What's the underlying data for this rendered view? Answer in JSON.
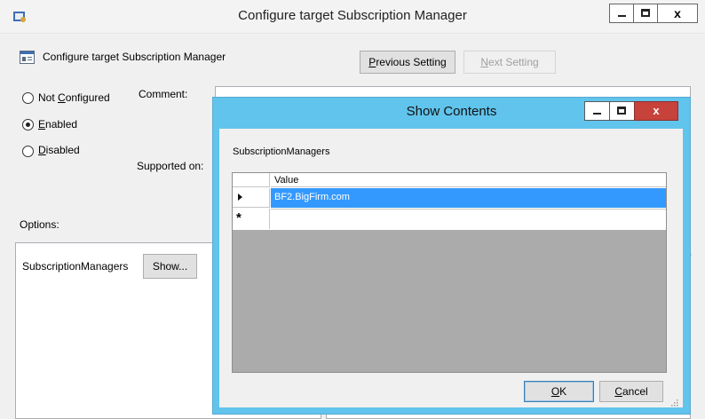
{
  "window": {
    "title": "Configure target Subscription Manager",
    "setting_name": "Configure target Subscription Manager",
    "previous_label": "Previous Setting",
    "next_label": "Next Setting"
  },
  "state": {
    "not_configured": "Not Configured",
    "enabled": "Enabled",
    "disabled": "Disabled",
    "selected": "Enabled"
  },
  "labels": {
    "comment": "Comment:",
    "supported_on": "Supported on:",
    "options": "Options:"
  },
  "options": {
    "field_label": "SubscriptionManagers",
    "show_button": "Show..."
  },
  "dialog": {
    "title": "Show Contents",
    "list_label": "SubscriptionManagers",
    "column_header": "Value",
    "rows": [
      "BF2.BigFirm.com"
    ],
    "new_row_marker": "*",
    "ok_label": "OK",
    "cancel_label": "Cancel"
  },
  "colors": {
    "dialog_frame": "#61c4ec",
    "selection": "#3399ff",
    "close_button": "#c7423b"
  }
}
